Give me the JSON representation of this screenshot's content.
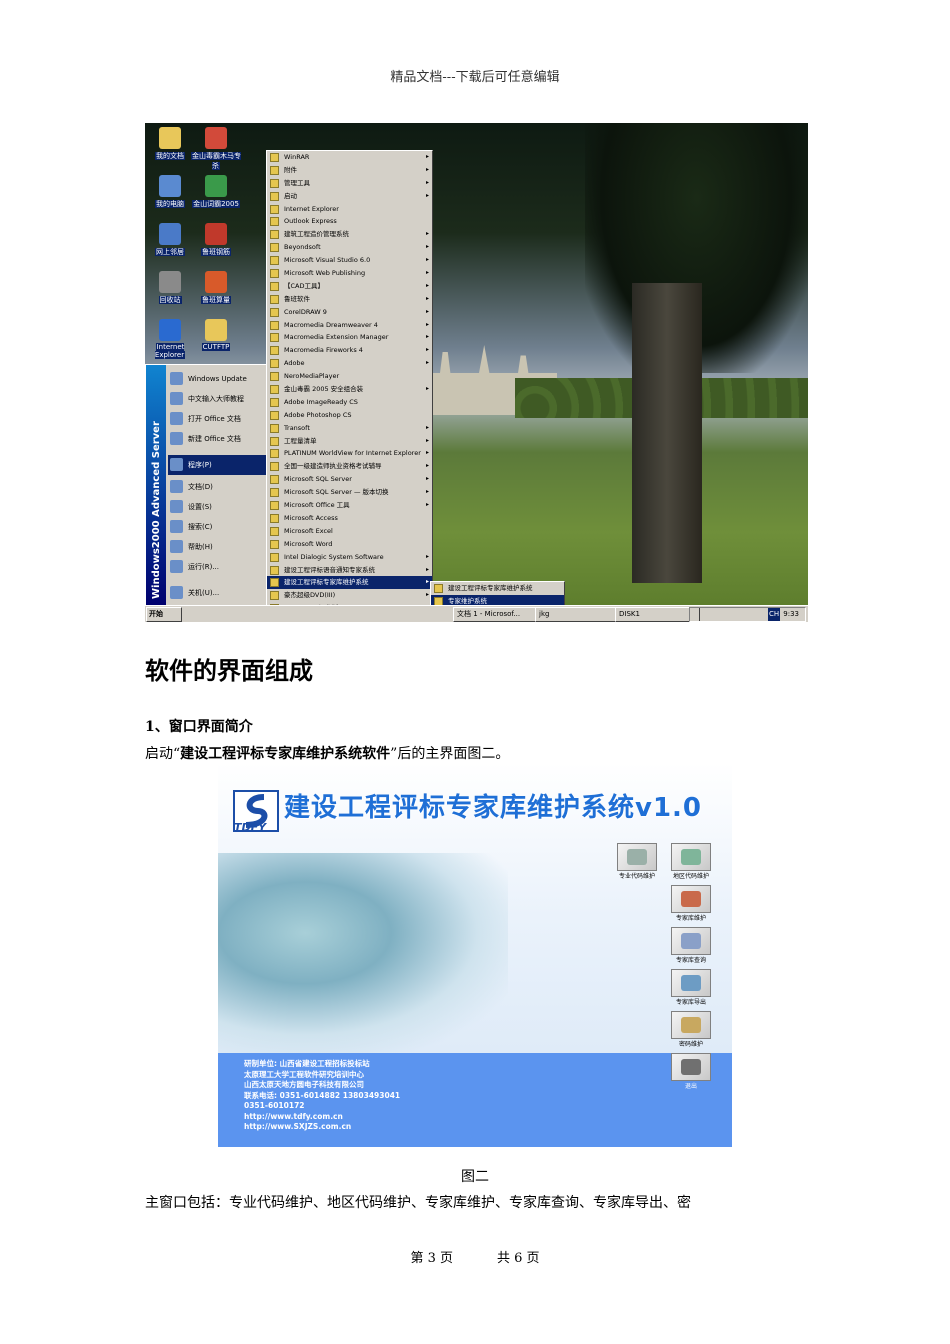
{
  "header": {
    "text": "精品文档---下载后可任意编辑"
  },
  "screenshot1": {
    "desktop_icons": [
      {
        "label": "我的文档"
      },
      {
        "label": "金山毒霸木马专杀"
      },
      {
        "label": "我的电脑"
      },
      {
        "label": "金山词霸2005"
      },
      {
        "label": "网上邻居"
      },
      {
        "label": "鲁班钢筋"
      },
      {
        "label": "回收站"
      },
      {
        "label": "鲁班算量"
      },
      {
        "label": "Internet Explorer"
      },
      {
        "label": "CUTFTP"
      }
    ],
    "start_band": "Windows2000 Advanced Server",
    "start_items": [
      {
        "label": "Windows Update"
      },
      {
        "label": "中文输入大师教程"
      },
      {
        "label": "打开 Office 文档"
      },
      {
        "label": "新建 Office 文档"
      },
      {
        "label": "程序(P)"
      },
      {
        "label": "文档(D)"
      },
      {
        "label": "设置(S)"
      },
      {
        "label": "搜索(C)"
      },
      {
        "label": "帮助(H)"
      },
      {
        "label": "运行(R)..."
      },
      {
        "label": "关机(U)..."
      }
    ],
    "programs_menu": [
      {
        "label": "WinRAR",
        "arrow": "▸"
      },
      {
        "label": "附件",
        "arrow": "▸"
      },
      {
        "label": "管理工具",
        "arrow": "▸"
      },
      {
        "label": "启动",
        "arrow": "▸"
      },
      {
        "label": "Internet Explorer",
        "arrow": ""
      },
      {
        "label": "Outlook Express",
        "arrow": ""
      },
      {
        "label": "建筑工程造价管理系统",
        "arrow": "▸"
      },
      {
        "label": "Beyondsoft",
        "arrow": "▸"
      },
      {
        "label": "Microsoft Visual Studio 6.0",
        "arrow": "▸"
      },
      {
        "label": "Microsoft Web Publishing",
        "arrow": "▸"
      },
      {
        "label": "【CAD工具】",
        "arrow": "▸"
      },
      {
        "label": "鲁班软件",
        "arrow": "▸"
      },
      {
        "label": "CorelDRAW 9",
        "arrow": "▸"
      },
      {
        "label": "Macromedia Dreamweaver 4",
        "arrow": "▸"
      },
      {
        "label": "Macromedia Extension Manager",
        "arrow": "▸"
      },
      {
        "label": "Macromedia Fireworks 4",
        "arrow": "▸"
      },
      {
        "label": "Adobe",
        "arrow": "▸"
      },
      {
        "label": "NeroMediaPlayer",
        "arrow": ""
      },
      {
        "label": "金山毒霸 2005 安全组合装",
        "arrow": "▸"
      },
      {
        "label": "Adobe ImageReady CS",
        "arrow": ""
      },
      {
        "label": "Adobe Photoshop CS",
        "arrow": ""
      },
      {
        "label": "Transoft",
        "arrow": "▸"
      },
      {
        "label": "工程量清单",
        "arrow": "▸"
      },
      {
        "label": "PLATINUM WorldView for Internet Explorer",
        "arrow": "▸"
      },
      {
        "label": "全国一级建造师执业资格考试辅导",
        "arrow": "▸"
      },
      {
        "label": "Microsoft SQL Server",
        "arrow": "▸"
      },
      {
        "label": "Microsoft SQL Server — 版本切换",
        "arrow": "▸"
      },
      {
        "label": "Microsoft Office 工具",
        "arrow": "▸"
      },
      {
        "label": "Microsoft Access",
        "arrow": ""
      },
      {
        "label": "Microsoft Excel",
        "arrow": ""
      },
      {
        "label": "Microsoft Word",
        "arrow": ""
      },
      {
        "label": "Intel Dialogic System Software",
        "arrow": "▸"
      },
      {
        "label": "建设工程评标语音通知专家系统",
        "arrow": "▸"
      },
      {
        "label": "建设工程评标专家库维护系统",
        "arrow": "▸"
      },
      {
        "label": "豪杰超级DVD(III)",
        "arrow": "▸"
      },
      {
        "label": "GoldWave 汉化版",
        "arrow": "▸"
      }
    ],
    "sub_menu": [
      {
        "label": "建设工程评标专家库维护系统"
      },
      {
        "label": "专家维护系统"
      }
    ],
    "taskbar": {
      "start": "开始",
      "btn1": "文档 1 - Microsof...",
      "btn2": "jkg",
      "btn3": "DISK1",
      "lang": "CH",
      "clock": "9:33"
    }
  },
  "section_title": "软件的界面组成",
  "subsection_title": "1、窗口界面简介",
  "intro": {
    "pre": "启动“",
    "bold": "建设工程评标专家库维护系统软件",
    "post": "”后的主界面图二。"
  },
  "screenshot2": {
    "title": "建设工程评标专家库维护系统v1.0",
    "logo": "TDFY",
    "buttons": [
      {
        "label": "专业代码维护",
        "color": "#9ab0a8"
      },
      {
        "label": "地区代码维护",
        "color": "#7fb59a"
      },
      {
        "label": "专家库维护",
        "color": "#c96a4b"
      },
      {
        "label": "专家库查询",
        "color": "#8aa0c8"
      },
      {
        "label": "专家库导出",
        "color": "#6d9cc4"
      },
      {
        "label": "密码维护",
        "color": "#c8a860"
      },
      {
        "label": "退出",
        "color": "#707070"
      }
    ],
    "info": [
      "研制单位:   山西省建设工程招标投标站",
      "               太原理工大学工程软件研究培训中心",
      "               山西太原天地方圆电子科技有限公司",
      "联系电话:   0351-6014882  13803493041",
      "               0351-6010172",
      "http://www.tdfy.com.cn",
      "http://www.SXJZS.com.cn"
    ]
  },
  "caption": "图二",
  "paragraph": "主窗口包括：专业代码维护、地区代码维护、专家库维护、专家库查询、专家库导出、密",
  "footer": {
    "page": "第 3 页",
    "total": "共 6 页"
  }
}
